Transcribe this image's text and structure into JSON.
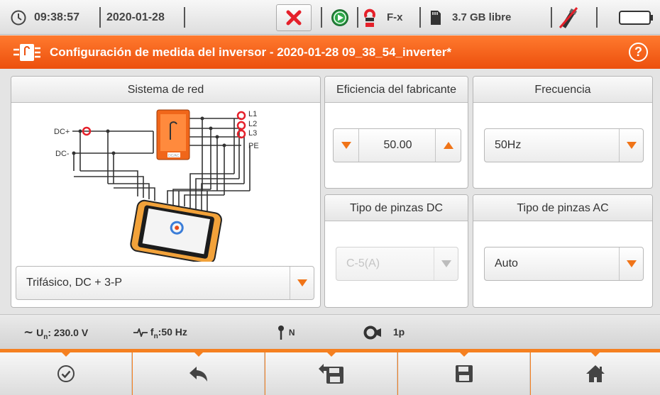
{
  "status": {
    "time": "09:38:57",
    "date": "2020-01-28",
    "phase": "F-x",
    "storage": "3.7 GB libre"
  },
  "titlebar": {
    "title": "Configuración de medida del inversor - 2020-01-28 09_38_54_inverter*"
  },
  "panels": {
    "network": {
      "header": "Sistema de red",
      "diagram_labels": {
        "dc_plus": "DC+",
        "dc_minus": "DC-",
        "l1": "L1",
        "l2": "L2",
        "l3": "L3",
        "pe": "PE",
        "inverter": "DC/AC"
      },
      "select_value": "Trifásico, DC + 3-P"
    },
    "efficiency": {
      "header": "Eficiencia del fabricante",
      "value": "50.00"
    },
    "frequency": {
      "header": "Frecuencia",
      "select_value": "50Hz"
    },
    "dc_clamps": {
      "header": "Tipo de pinzas DC",
      "select_value": "C-5(A)"
    },
    "ac_clamps": {
      "header": "Tipo de pinzas AC",
      "select_value": "Auto"
    }
  },
  "infobar": {
    "un_label": "U",
    "un_sub": "n",
    "un_value": ": 230.0 V",
    "fn_label": "f",
    "fn_sub": "n",
    "fn_value": ":50 Hz",
    "neutral": "N",
    "clamp_count": "1p"
  },
  "colors": {
    "accent": "#f07418",
    "titlebar": "#ec4f0d",
    "close": "#e5202a",
    "play": "#2fa84a"
  }
}
